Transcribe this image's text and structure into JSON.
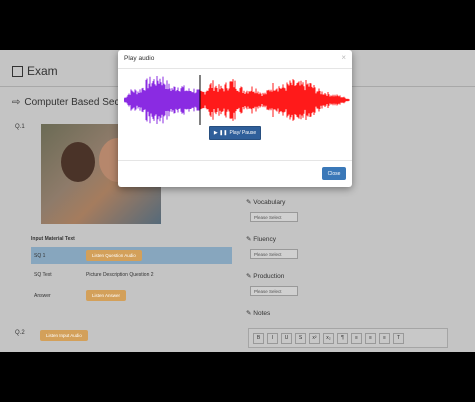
{
  "page": {
    "title": "Exam",
    "section": "Computer Based Sect",
    "q1": "Q.1",
    "q2": "Q.2",
    "input_material_text": "Input Material Text",
    "rows": [
      {
        "label": "SQ 1",
        "button": "Listen Question Audio"
      },
      {
        "label": "SQ Text",
        "text": "Picture Description Question 2"
      },
      {
        "label": "Answer",
        "button": "Listen Answer"
      }
    ],
    "listen_input_audio": "Listen Input Audio",
    "right_panel": {
      "vocabulary": "Vocabulary",
      "fluency": "Fluency",
      "production": "Production",
      "notes": "Notes",
      "select_placeholder": "Please Select"
    },
    "toolbar": [
      "B",
      "I",
      "U",
      "S",
      "x²",
      "x₂",
      "¶",
      "≡",
      "≡",
      "≡",
      "T"
    ]
  },
  "modal": {
    "title": "Play audio",
    "close_glyph": "×",
    "play_pause_label": "Play/ Pause",
    "close_label": "Close"
  },
  "colors": {
    "played": "#8a2be2",
    "unplayed": "#ff1a1a",
    "cursor": "#000000",
    "primary_button": "#3a78b8"
  }
}
